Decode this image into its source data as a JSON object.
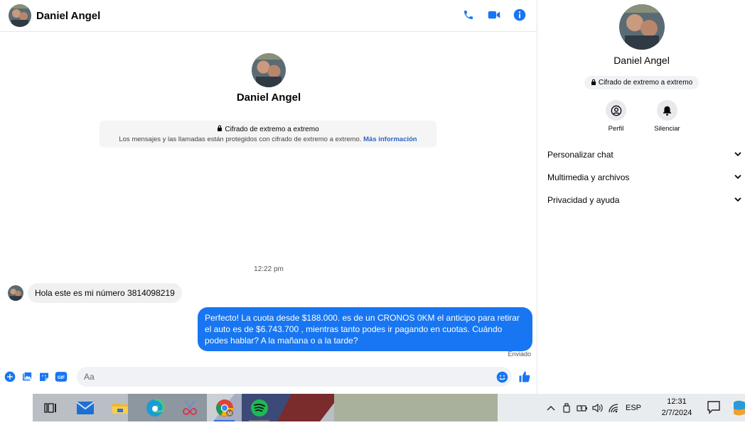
{
  "header": {
    "contact_name": "Daniel Angel",
    "icons": [
      "phone-icon",
      "video-camera-icon",
      "info-icon"
    ]
  },
  "intro": {
    "contact_name": "Daniel Angel",
    "e2e_title": "Cifrado de extremo a extremo",
    "e2e_description": "Los mensajes y las llamadas están protegidos con cifrado de extremo a extremo.",
    "e2e_link": "Más información"
  },
  "conversation": {
    "timestamp": "12:22 pm",
    "incoming": "Hola este es mi número 3814098219",
    "outgoing": "Perfecto! La cuota desde $188.000. es de un CRONOS 0KM el anticipo para retirar el auto es de $6.743.700 , mientras tanto podes ir pagando en cuotas. Cuándo podes hablar? A la mañana o a la tarde?",
    "sent_status": "Enviado"
  },
  "composer": {
    "placeholder": "Aa",
    "icons": [
      "plus-circle-icon",
      "photo-icon",
      "sticker-icon",
      "gif-icon",
      "emoji-icon",
      "thumbs-up-icon"
    ],
    "gif_label": "GIF"
  },
  "side": {
    "contact_name": "Daniel Angel",
    "badge": "Cifrado de extremo a extremo",
    "actions": [
      {
        "label": "Perfil",
        "icon": "profile-icon"
      },
      {
        "label": "Silenciar",
        "icon": "bell-icon"
      }
    ],
    "menu": [
      {
        "label": "Personalizar chat"
      },
      {
        "label": "Multimedia y archivos"
      },
      {
        "label": "Privacidad y ayuda"
      }
    ]
  },
  "taskbar": {
    "apps": [
      "task-view-icon",
      "mail-icon",
      "file-explorer-icon",
      "edge-icon",
      "snipping-tool-icon",
      "chrome-icon",
      "spotify-icon"
    ],
    "language": "ESP",
    "time": "12:31",
    "date": "2/7/2024"
  },
  "colors": {
    "accent": "#1876f2",
    "link": "#2c64c6"
  }
}
